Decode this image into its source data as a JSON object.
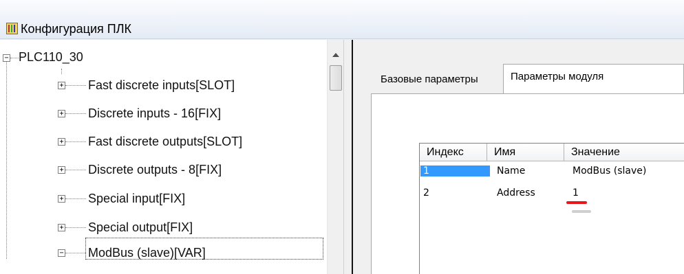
{
  "window": {
    "title": "Конфигурация ПЛК",
    "icon": "plc-config-icon"
  },
  "tree": {
    "root": {
      "label": "PLC110_30",
      "expander": "⊟"
    },
    "items": [
      {
        "label": "Fast discrete inputs[SLOT]",
        "expander": "+"
      },
      {
        "label": "Discrete inputs - 16[FIX]",
        "expander": "+"
      },
      {
        "label": "Fast discrete outputs[SLOT]",
        "expander": "+"
      },
      {
        "label": "Discrete outputs - 8[FIX]",
        "expander": "+"
      },
      {
        "label": "Special input[FIX]",
        "expander": "+"
      },
      {
        "label": "Special output[FIX]",
        "expander": "+"
      },
      {
        "label": "ModBus (slave)[VAR]",
        "expander": "−",
        "selected": true
      }
    ]
  },
  "tabs": [
    {
      "label": "Базовые параметры",
      "active": false
    },
    {
      "label": "Параметры модуля",
      "active": true
    }
  ],
  "params_table": {
    "columns": [
      "Индекс",
      "Имя",
      "Значение"
    ],
    "rows": [
      {
        "index": "1",
        "name": "Name",
        "value": "ModBus (slave)",
        "selected": true
      },
      {
        "index": "2",
        "name": "Address",
        "value": "1",
        "selected": false
      }
    ]
  },
  "colors": {
    "selection": "#3399ff",
    "annotation_underline": "#e8151b"
  }
}
